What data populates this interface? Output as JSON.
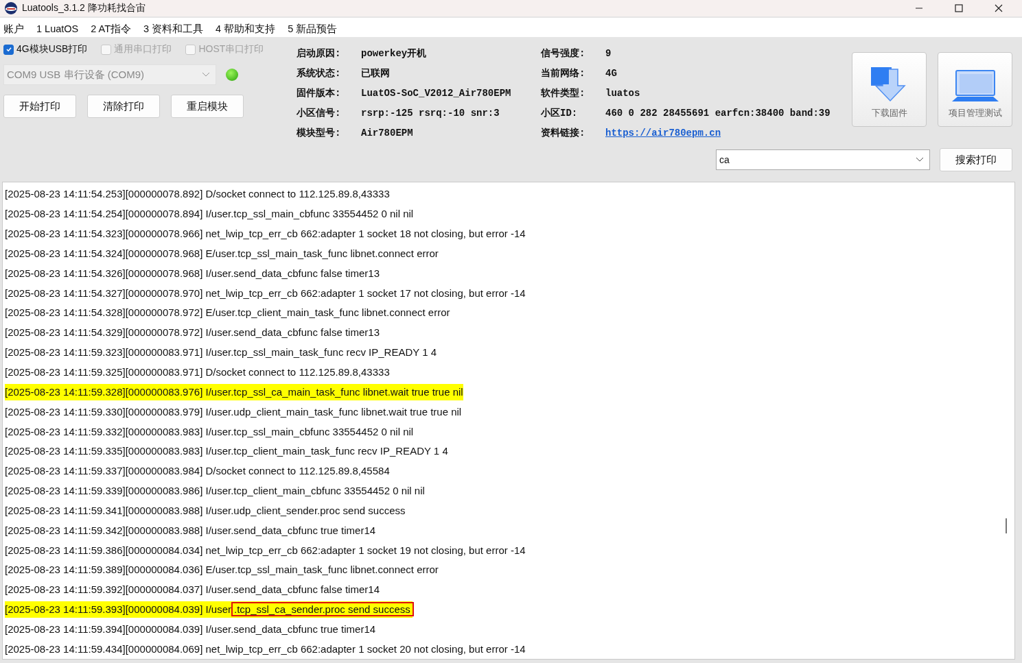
{
  "window": {
    "title": "Luatools_3.1.2 降功耗找合宙"
  },
  "menu": [
    "账户",
    "1 LuatOS",
    "2 AT指令",
    "3 资料和工具",
    "4 帮助和支持",
    "5 新品预告"
  ],
  "print_options": [
    {
      "label": "4G模块USB打印",
      "checked": true,
      "disabled": false
    },
    {
      "label": "通用串口打印",
      "checked": false,
      "disabled": true
    },
    {
      "label": "HOST串口打印",
      "checked": false,
      "disabled": true
    }
  ],
  "port": {
    "value": "COM9 USB 串行设备 (COM9)",
    "connected": true
  },
  "buttons": [
    "开始打印",
    "清除打印",
    "重启模块"
  ],
  "info": [
    {
      "label": "启动原因:",
      "value": "powerkey开机",
      "kind": "text"
    },
    {
      "label": "信号强度:",
      "value": "9",
      "kind": "text"
    },
    {
      "label": "系统状态:",
      "value": "已联网",
      "kind": "text"
    },
    {
      "label": "当前网络:",
      "value": "4G",
      "kind": "text"
    },
    {
      "label": "固件版本:",
      "value": "LuatOS-SoC_V2012_Air780EPM",
      "kind": "text"
    },
    {
      "label": "软件类型:",
      "value": "luatos",
      "kind": "text"
    },
    {
      "label": "小区信号:",
      "value": "rsrp:-125 rsrq:-10 snr:3",
      "kind": "text"
    },
    {
      "label": "小区ID:",
      "value": "460 0 282 28455691 earfcn:38400 band:39",
      "kind": "text"
    },
    {
      "label": "模块型号:",
      "value": "Air780EPM",
      "kind": "text"
    },
    {
      "label": "资料链接:",
      "value": "https://air780epm.cn",
      "kind": "link"
    }
  ],
  "tools": [
    {
      "label": "下载固件",
      "kind": "download"
    },
    {
      "label": "项目管理测试",
      "kind": "laptop"
    }
  ],
  "search": {
    "value": "ca",
    "button": "搜索打印"
  },
  "log": [
    {
      "text": "[2025-08-23 14:11:54.253][000000078.892] D/socket connect to 112.125.89.8,43333",
      "highlighted": false
    },
    {
      "text": "[2025-08-23 14:11:54.254][000000078.894] I/user.tcp_ssl_main_cbfunc 33554452 0 nil nil",
      "highlighted": false
    },
    {
      "text": "[2025-08-23 14:11:54.323][000000078.966] net_lwip_tcp_err_cb 662:adapter 1 socket 18 not closing, but error -14",
      "highlighted": false
    },
    {
      "text": "[2025-08-23 14:11:54.324][000000078.968] E/user.tcp_ssl_main_task_func libnet.connect error",
      "highlighted": false
    },
    {
      "text": "[2025-08-23 14:11:54.326][000000078.968] I/user.send_data_cbfunc false timer13",
      "highlighted": false
    },
    {
      "text": "[2025-08-23 14:11:54.327][000000078.970] net_lwip_tcp_err_cb 662:adapter 1 socket 17 not closing, but error -14",
      "highlighted": false
    },
    {
      "text": "[2025-08-23 14:11:54.328][000000078.972] E/user.tcp_client_main_task_func libnet.connect error",
      "highlighted": false
    },
    {
      "text": "[2025-08-23 14:11:54.329][000000078.972] I/user.send_data_cbfunc false timer13",
      "highlighted": false
    },
    {
      "text": "[2025-08-23 14:11:59.323][000000083.971] I/user.tcp_ssl_main_task_func recv IP_READY 1 4",
      "highlighted": false
    },
    {
      "text": "[2025-08-23 14:11:59.325][000000083.971] D/socket connect to 112.125.89.8,43333",
      "highlighted": false
    },
    {
      "text": "[2025-08-23 14:11:59.328][000000083.976] I/user.tcp_ssl_ca_main_task_func libnet.wait true true nil",
      "highlighted": true
    },
    {
      "text": "[2025-08-23 14:11:59.330][000000083.979] I/user.udp_client_main_task_func libnet.wait true true nil",
      "highlighted": false
    },
    {
      "text": "[2025-08-23 14:11:59.332][000000083.983] I/user.tcp_ssl_main_cbfunc 33554452 0 nil nil",
      "highlighted": false
    },
    {
      "text": "[2025-08-23 14:11:59.335][000000083.983] I/user.tcp_client_main_task_func recv IP_READY 1 4",
      "highlighted": false
    },
    {
      "text": "[2025-08-23 14:11:59.337][000000083.984] D/socket connect to 112.125.89.8,45584",
      "highlighted": false
    },
    {
      "text": "[2025-08-23 14:11:59.339][000000083.986] I/user.tcp_client_main_cbfunc 33554452 0 nil nil",
      "highlighted": false
    },
    {
      "text": "[2025-08-23 14:11:59.341][000000083.988] I/user.udp_client_sender.proc send success",
      "highlighted": false
    },
    {
      "text": "[2025-08-23 14:11:59.342][000000083.988] I/user.send_data_cbfunc true timer14",
      "highlighted": false
    },
    {
      "text": "[2025-08-23 14:11:59.386][000000084.034] net_lwip_tcp_err_cb 662:adapter 1 socket 19 not closing, but error -14",
      "highlighted": false
    },
    {
      "text": "[2025-08-23 14:11:59.389][000000084.036] E/user.tcp_ssl_main_task_func libnet.connect error",
      "highlighted": false
    },
    {
      "text": "[2025-08-23 14:11:59.392][000000084.037] I/user.send_data_cbfunc false timer14",
      "highlighted": false
    },
    {
      "text": "[2025-08-23 14:11:59.393][000000084.039] I/user",
      "boxed": ".tcp_ssl_ca_sender.proc send success",
      "highlighted": true
    },
    {
      "text": "[2025-08-23 14:11:59.394][000000084.039] I/user.send_data_cbfunc true timer14",
      "highlighted": false
    },
    {
      "text": "[2025-08-23 14:11:59.434][000000084.069] net_lwip_tcp_err_cb 662:adapter 1 socket 20 not closing, but error -14",
      "highlighted": false
    }
  ]
}
